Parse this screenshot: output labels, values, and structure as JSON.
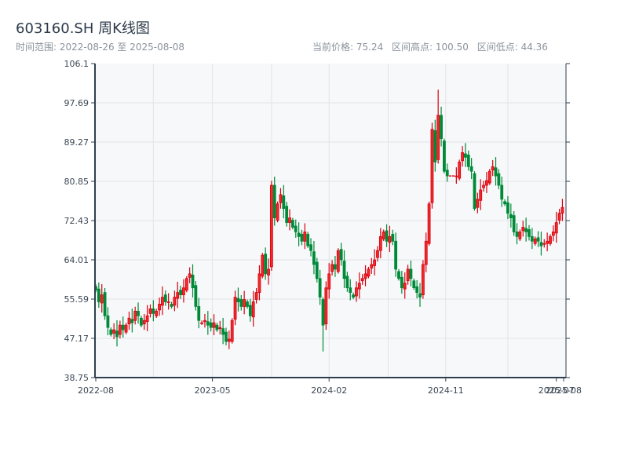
{
  "header": {
    "title": "603160.SH 周K线图",
    "range_label": "时间范围: 2022-08-26 至 2025-08-08",
    "current_price": "当前价格: 75.24",
    "range_high": "区间高点: 100.50",
    "range_low": "区间低点: 44.36"
  },
  "colors": {
    "up": "#d9000f",
    "down": "#008a38",
    "axis": "#2f3e4e",
    "grid": "#e2e4e8",
    "plot_bg": "#f6f8fa"
  },
  "chart_data": {
    "type": "candlestick",
    "title": "603160.SH 周K线图",
    "interval": "weekly",
    "start_date": "2022-08-26",
    "end_date": "2025-08-08",
    "ylim": [
      38.75,
      106.1
    ],
    "y_ticks": [
      "106.1",
      "97.69",
      "89.27",
      "80.85",
      "72.43",
      "64.01",
      "55.59",
      "47.17",
      "38.75"
    ],
    "x_ticks": [
      {
        "label": "2022-08",
        "week": 0
      },
      {
        "label": "2023-05",
        "week": 38.5
      },
      {
        "label": "2024-02",
        "week": 77
      },
      {
        "label": "2024-11",
        "week": 115.5
      },
      {
        "label": "2025-07",
        "week": 152
      },
      {
        "label": "2025-08",
        "week": 154.4
      }
    ],
    "grid_weeks": [
      19,
      38.5,
      58,
      77,
      96.5,
      115.5,
      136
    ],
    "high_point": {
      "week": 113,
      "value": 100.5
    },
    "low_point": {
      "week": 75,
      "value": 44.36
    },
    "suspended_weeks": [
      117,
      118
    ],
    "close": [
      57.5,
      55,
      56.5,
      52,
      49.5,
      48,
      49,
      47.5,
      50,
      49,
      50,
      51.5,
      50.5,
      53,
      52,
      50,
      51,
      52,
      53.5,
      52.5,
      53,
      54.5,
      56,
      55,
      55,
      54,
      56,
      57,
      56.5,
      58,
      60,
      61,
      58,
      54,
      51,
      50.5,
      51,
      50,
      49.5,
      50.5,
      49,
      49.5,
      48,
      46.5,
      47,
      51,
      56,
      55,
      54,
      55.5,
      54,
      52,
      55,
      57,
      61,
      65,
      61,
      62,
      80,
      73,
      76,
      78,
      75,
      72,
      73,
      71,
      70,
      69,
      68,
      70,
      67,
      66,
      63,
      60,
      56,
      50,
      58,
      61,
      63,
      62,
      66,
      64,
      60,
      58,
      57,
      56,
      58,
      59,
      60,
      61,
      62,
      63,
      64,
      66,
      69,
      70,
      68,
      69,
      68,
      62,
      60,
      58,
      59,
      62,
      60,
      58,
      57,
      56,
      63,
      68,
      76,
      92,
      85,
      95,
      90,
      83,
      82,
      82,
      82,
      82,
      85,
      87,
      86,
      84,
      83,
      75,
      77,
      79,
      80,
      81,
      83,
      84,
      82,
      80,
      77,
      76,
      74,
      73,
      70,
      69,
      70,
      71,
      70,
      69,
      68,
      68.5,
      68,
      67,
      67.5,
      68,
      69,
      70,
      72,
      74,
      75.24
    ]
  }
}
